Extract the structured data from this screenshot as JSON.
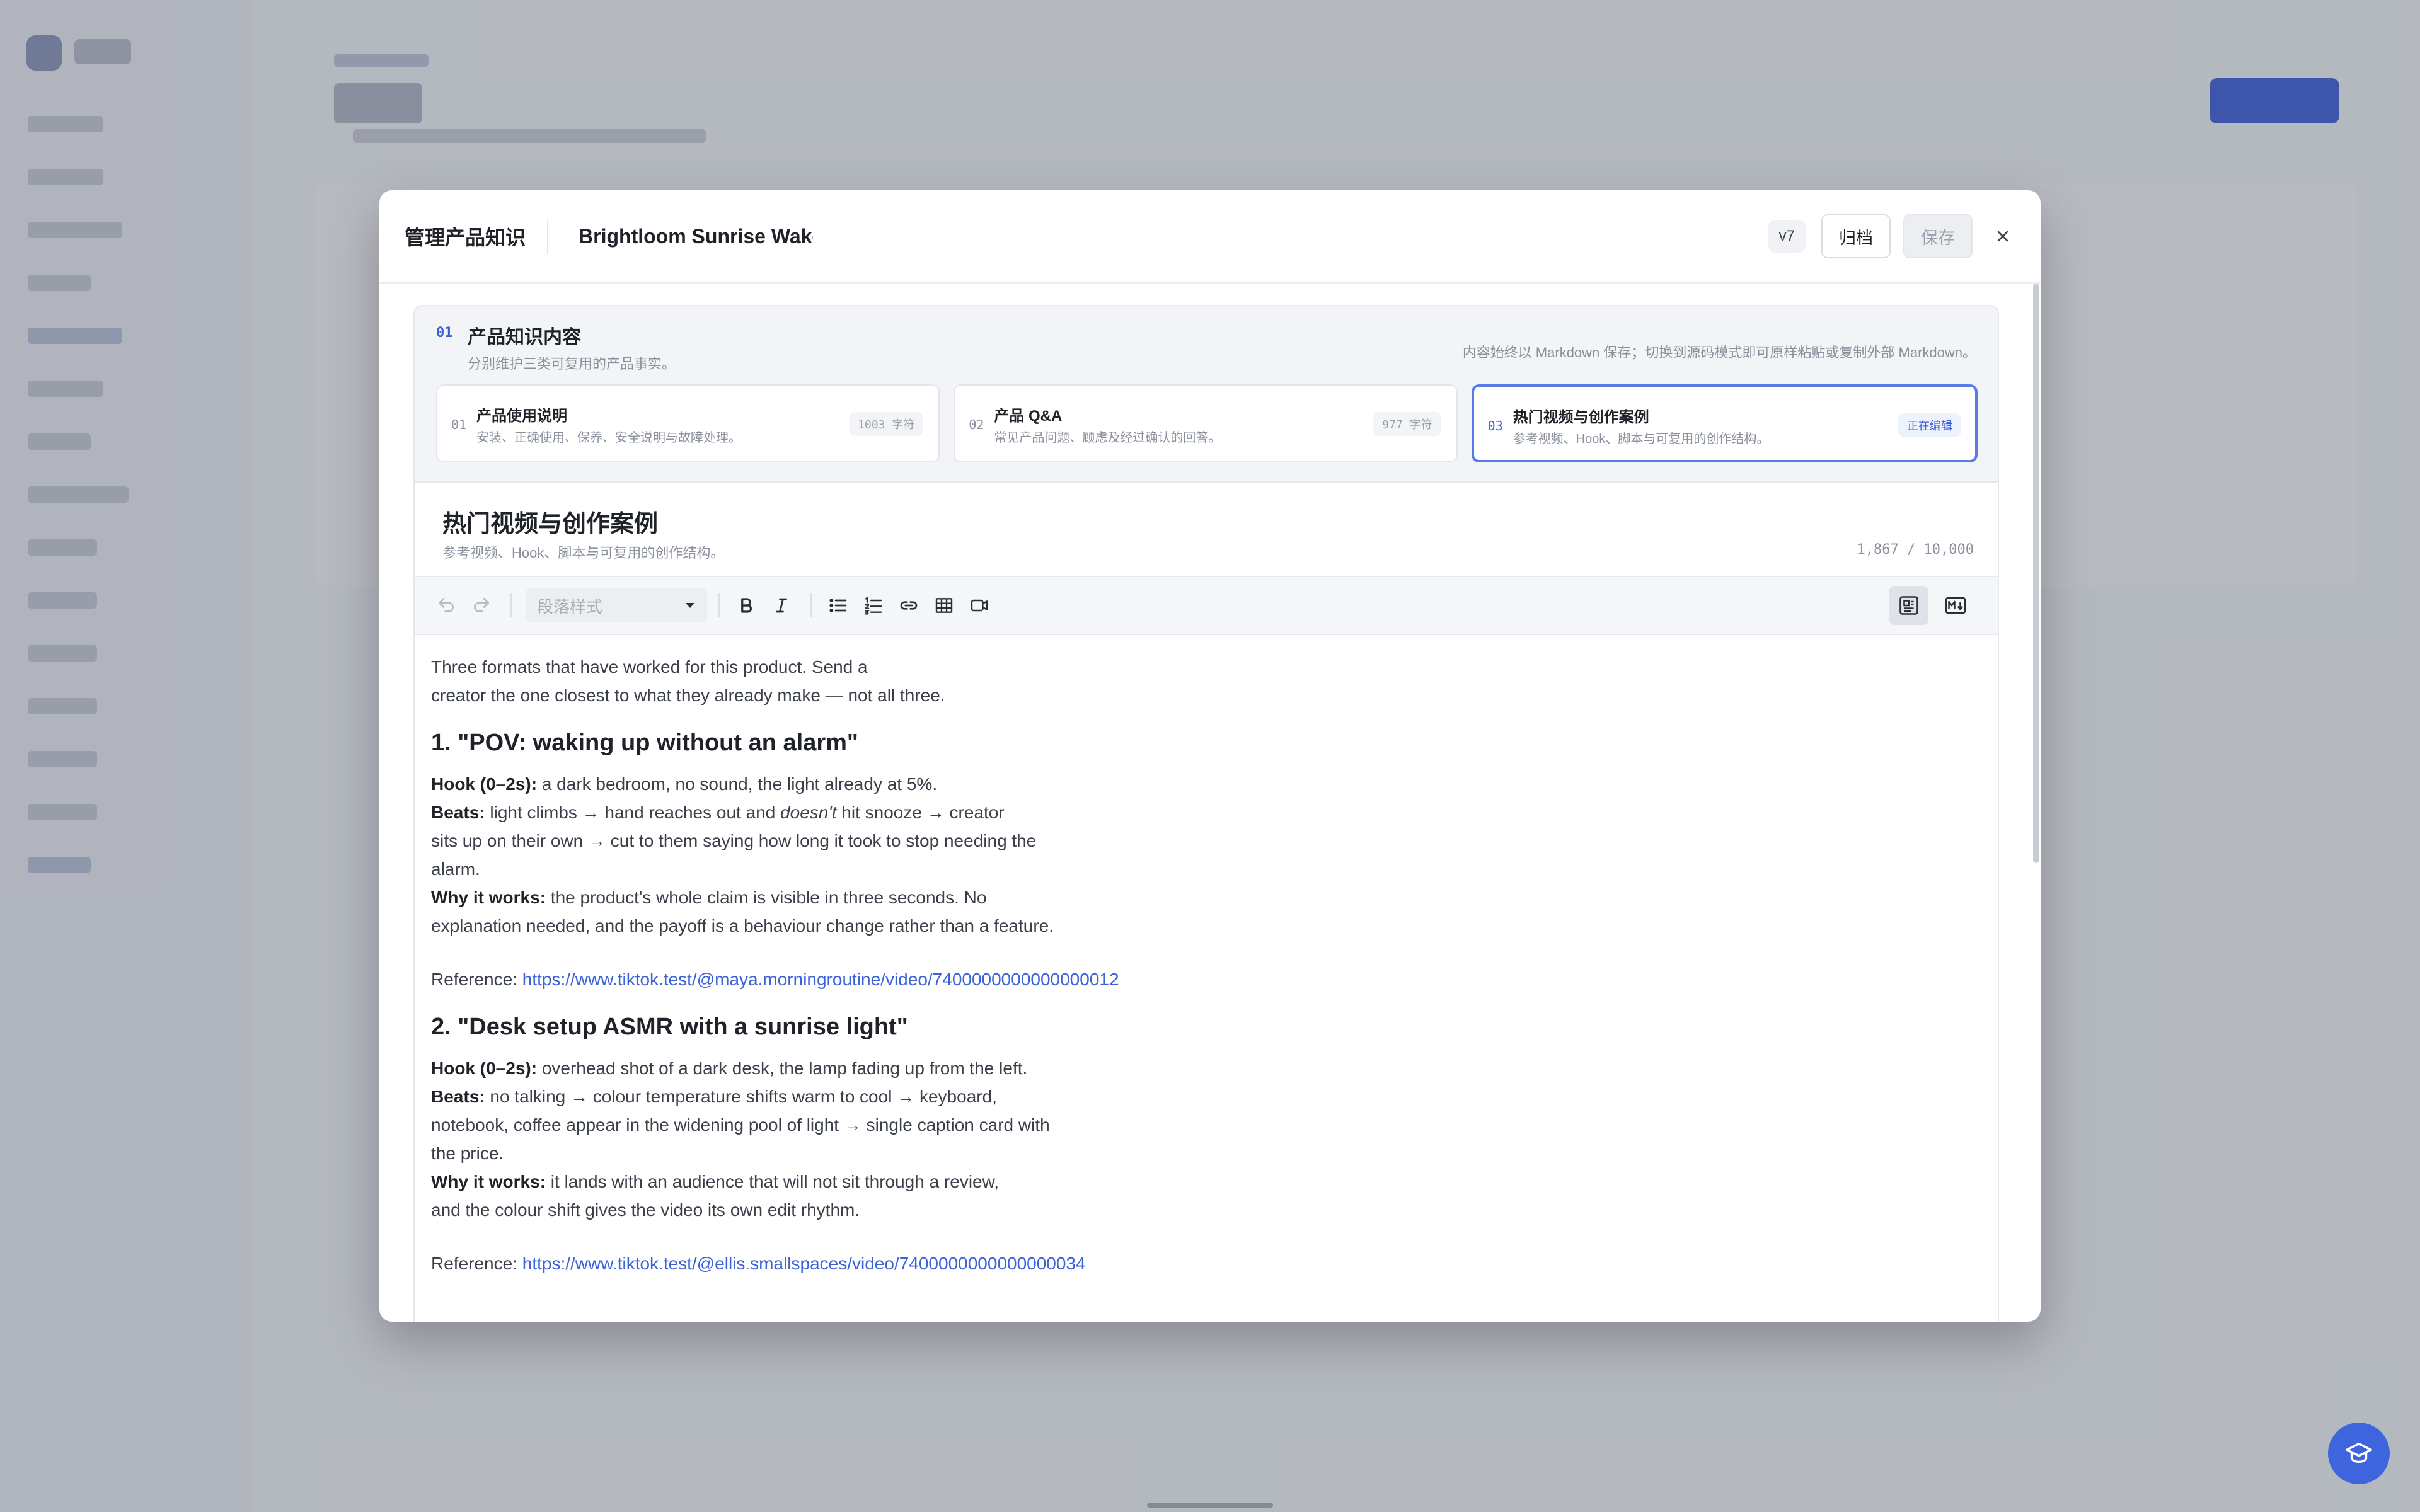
{
  "modal": {
    "title": "管理产品知识",
    "product_name": "Brightloom Sunrise Wake",
    "version": "v7",
    "archive_label": "归档",
    "save_label": "保存",
    "close_label": "×"
  },
  "section": {
    "num": "01",
    "title": "产品知识内容",
    "subtitle": "分别维护三类可复用的产品事实。",
    "note": "内容始终以 Markdown 保存；切换到源码模式即可原样粘贴或复制外部 Markdown。"
  },
  "tabs": [
    {
      "num": "01",
      "title": "产品使用说明",
      "desc": "安装、正确使用、保养、安全说明与故障处理。",
      "count": "1003 字符"
    },
    {
      "num": "02",
      "title": "产品 Q&A",
      "desc": "常见产品问题、顾虑及经过确认的回答。",
      "count": "977 字符"
    },
    {
      "num": "03",
      "title": "热门视频与创作案例",
      "desc": "参考视频、Hook、脚本与可复用的创作结构。",
      "status": "正在编辑"
    }
  ],
  "editor": {
    "title": "热门视频与创作案例",
    "subtitle": "参考视频、Hook、脚本与可复用的创作结构。",
    "char_count": "1,867 / 10,000",
    "paragraph_style_placeholder": "段落样式"
  },
  "content": {
    "intro_1": "Three formats that have worked for this product. Send a",
    "intro_2": "creator the one closest to what they already make — not all three.",
    "h1": "1. \"POV: waking up without an alarm\"",
    "s1": {
      "hook_label": "Hook (0–2s):",
      "hook_text": " a dark bedroom, no sound, the light already at 5%.",
      "beats_label": "Beats:",
      "beats_pre": " light climbs → hand reaches out and ",
      "beats_em": "doesn't",
      "beats_post": " hit snooze → creator",
      "beats_line2": "sits up on their own → cut to them saying how long it took to stop needing the",
      "beats_line3": "alarm.",
      "why_label": "Why it works:",
      "why_text": " the product's whole claim is visible in three seconds. No",
      "why_line2": "explanation needed, and the payoff is a behaviour change rather than a feature.",
      "ref_label": "Reference: ",
      "ref_url": "https://www.tiktok.test/@maya.morningroutine/video/7400000000000000012"
    },
    "h2": "2. \"Desk setup ASMR with a sunrise light\"",
    "s2": {
      "hook_label": "Hook (0–2s):",
      "hook_text": " overhead shot of a dark desk, the lamp fading up from the left.",
      "beats_label": "Beats:",
      "beats_text": " no talking → colour temperature shifts warm to cool → keyboard,",
      "beats_line2": "notebook, coffee appear in the widening pool of light → single caption card with",
      "beats_line3": "the price.",
      "why_label": "Why it works:",
      "why_text": " it lands with an audience that will not sit through a review,",
      "why_line2": "and the colour shift gives the video its own edit rhythm.",
      "ref_label": "Reference: ",
      "ref_url": "https://www.tiktok.test/@ellis.smallspaces/video/7400000000000000034"
    }
  },
  "icons": {
    "undo": "undo-icon",
    "redo": "redo-icon",
    "bold": "bold-icon",
    "italic": "italic-icon",
    "bullet_list": "bullet-list-icon",
    "numbered_list": "numbered-list-icon",
    "link": "link-icon",
    "table": "table-icon",
    "video": "video-icon",
    "rich_mode": "rich-text-mode-icon",
    "markdown_mode": "markdown-mode-icon",
    "help": "graduation-cap-icon"
  },
  "colors": {
    "accent": "#3c5fd6",
    "link": "#3c62d8",
    "help_button": "#3e64de"
  }
}
